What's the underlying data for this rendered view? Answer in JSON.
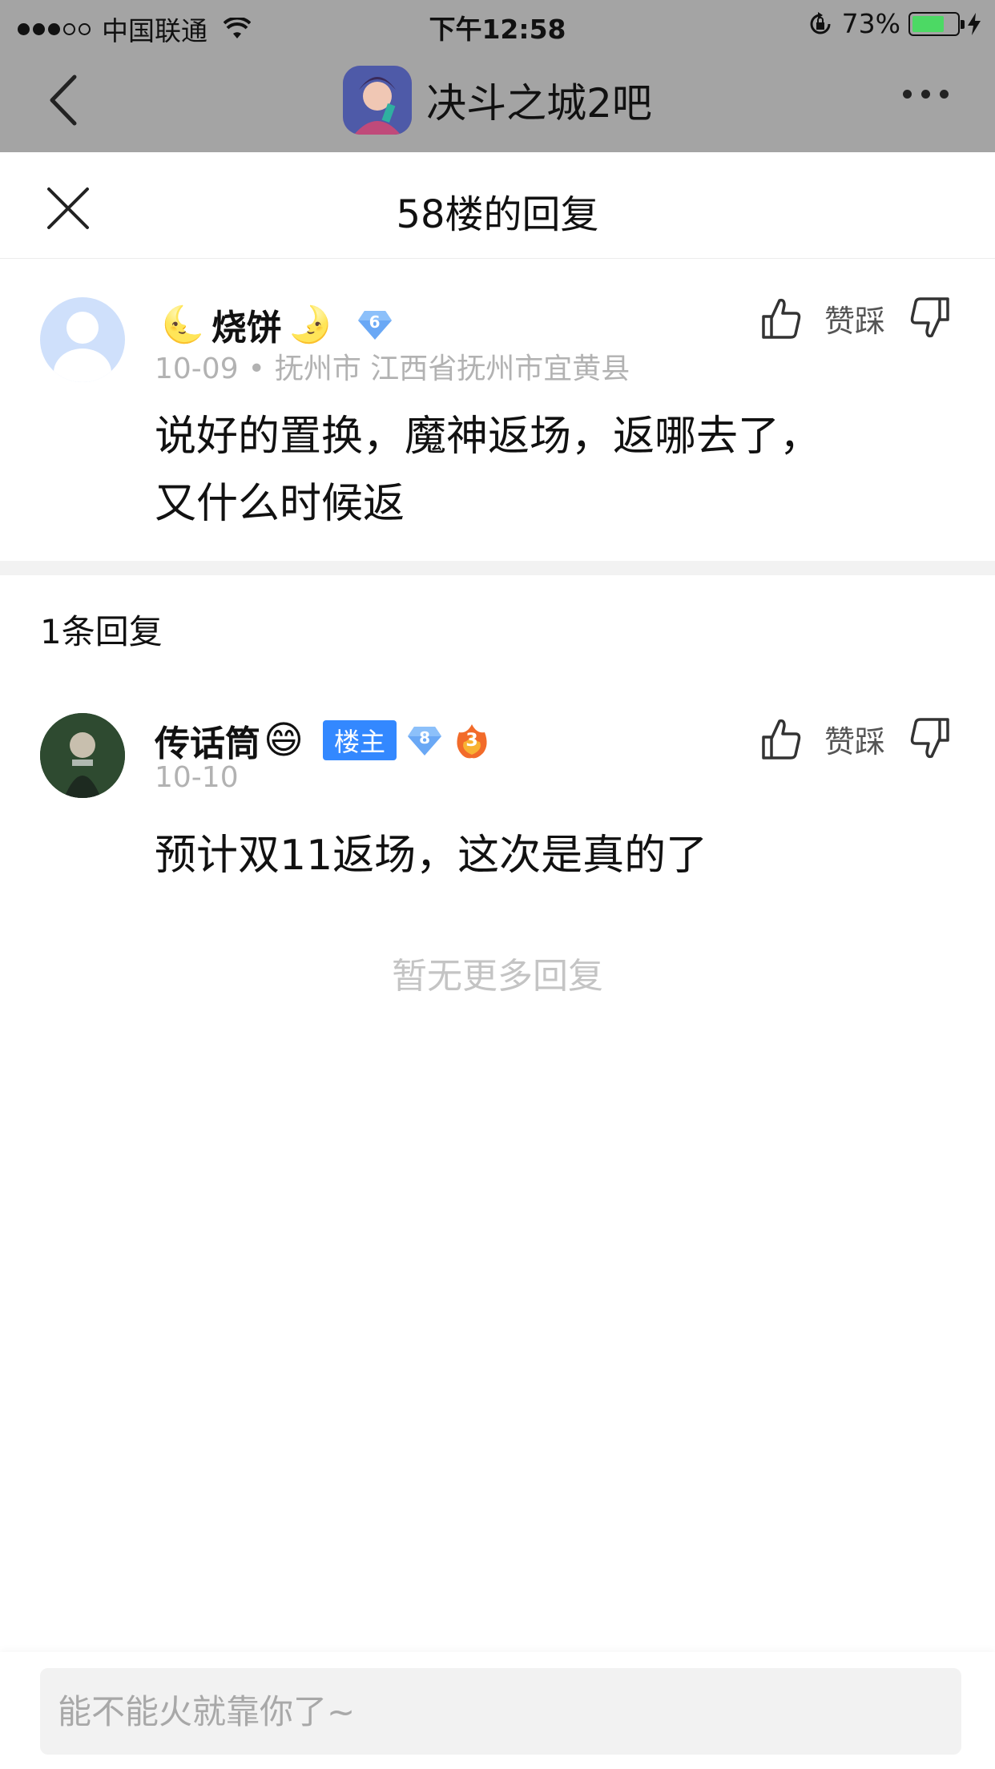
{
  "status_bar": {
    "carrier": "中国联通",
    "time": "下午12:58",
    "battery_percent": "73%",
    "battery_level": 0.73,
    "signal_bars_filled": 3,
    "signal_bars_total": 5
  },
  "app_bar": {
    "forum_name": "决斗之城2吧",
    "icons": [
      "back-icon",
      "more-icon"
    ]
  },
  "sheet": {
    "title": "58楼的回复",
    "close_icon": "close-icon"
  },
  "main_post": {
    "username": "烧饼",
    "name_decorations": [
      "🌜",
      "🌛"
    ],
    "level": "6",
    "date": "10-09",
    "location": "抚州市 江西省抚州市宜黄县",
    "content_lines": [
      "说好的置换，魔神返场，返哪去了，",
      "又什么时候返"
    ],
    "action_label": "赞踩"
  },
  "replies_section": {
    "count_label": "1条回复",
    "no_more_label": "暂无更多回复"
  },
  "reply": {
    "username": "传话筒",
    "emoji": "😄",
    "owner_badge": "楼主",
    "level": "8",
    "fire_level": "3",
    "date": "10-10",
    "content": "预计双11返场，这次是真的了",
    "action_label": "赞踩"
  },
  "input": {
    "placeholder": "能不能火就靠你了~"
  },
  "colors": {
    "accent": "#3388ff",
    "dim_header": "#a4a4a4",
    "battery": "#4cd964",
    "meta_text": "#b2b2b2"
  }
}
